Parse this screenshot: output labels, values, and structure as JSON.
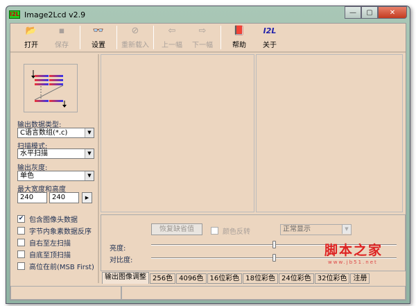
{
  "window": {
    "title": "Image2Lcd v2.9",
    "app_icon": "I2L",
    "controls": {
      "minimize": "—",
      "maximize": "▢",
      "close": "✕"
    }
  },
  "toolbar": [
    {
      "label": "打开",
      "icon": "open-folder-icon",
      "glyph": "📂",
      "enabled": true
    },
    {
      "label": "保存",
      "icon": "save-icon",
      "glyph": "▪",
      "enabled": false
    },
    {
      "label": "设置",
      "icon": "settings-glasses-icon",
      "glyph": "👓",
      "enabled": true
    },
    {
      "label": "重新载入",
      "icon": "reload-icon",
      "glyph": "⊘",
      "enabled": false
    },
    {
      "label": "上一幅",
      "icon": "previous-icon",
      "glyph": "⇦",
      "enabled": false
    },
    {
      "label": "下一幅",
      "icon": "next-icon",
      "glyph": "⇨",
      "enabled": false
    },
    {
      "label": "帮助",
      "icon": "help-book-icon",
      "glyph": "📕",
      "enabled": true
    },
    {
      "label": "关于",
      "icon": "about-icon",
      "glyph": "I2L",
      "enabled": true
    }
  ],
  "left": {
    "output_type_label": "输出数据类型:",
    "output_type_value": "C语言数组(*.c)",
    "scan_mode_label": "扫描模式:",
    "scan_mode_value": "水平扫描",
    "gray_label": "输出灰度:",
    "gray_value": "单色",
    "size_label": "最大宽度和高度",
    "width": "240",
    "height": "240",
    "options": [
      {
        "label": "包含图像头数据",
        "checked": true
      },
      {
        "label": "字节内象素数据反序",
        "checked": false
      },
      {
        "label": "自右至左扫描",
        "checked": false
      },
      {
        "label": "自底至顶扫描",
        "checked": false
      },
      {
        "label": "高位在前(MSB First)",
        "checked": false
      }
    ]
  },
  "adjust": {
    "restore_label": "恢复缺省值",
    "invert_label": "颜色反转",
    "invert_checked": false,
    "display_mode": "正常显示",
    "brightness_label": "亮度:",
    "contrast_label": "对比度:",
    "brightness": 50,
    "contrast": 50
  },
  "tabs": [
    "输出图像调整",
    "256色",
    "4096色",
    "16位彩色",
    "18位彩色",
    "24位彩色",
    "32位彩色",
    "注册"
  ],
  "active_tab": 0,
  "watermark": {
    "text": "脚本之家",
    "url": "www.jb51.net"
  }
}
